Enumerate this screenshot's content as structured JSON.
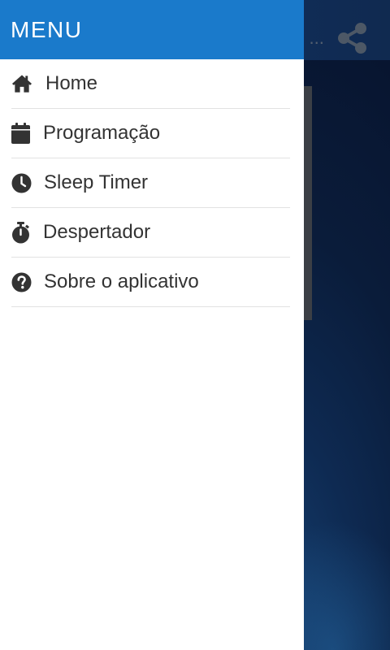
{
  "background_app": {
    "title_fragment": "..., ...",
    "share_icon": "share-icon",
    "theme_color": "#0a1c3a"
  },
  "drawer": {
    "title": "MENU",
    "header_color": "#1a7acb",
    "items": [
      {
        "label": "Home",
        "icon": "home-icon"
      },
      {
        "label": "Programação",
        "icon": "calendar-icon"
      },
      {
        "label": "Sleep Timer",
        "icon": "clock-icon"
      },
      {
        "label": "Despertador",
        "icon": "stopwatch-icon"
      },
      {
        "label": "Sobre o aplicativo",
        "icon": "help-circle-icon"
      }
    ]
  }
}
